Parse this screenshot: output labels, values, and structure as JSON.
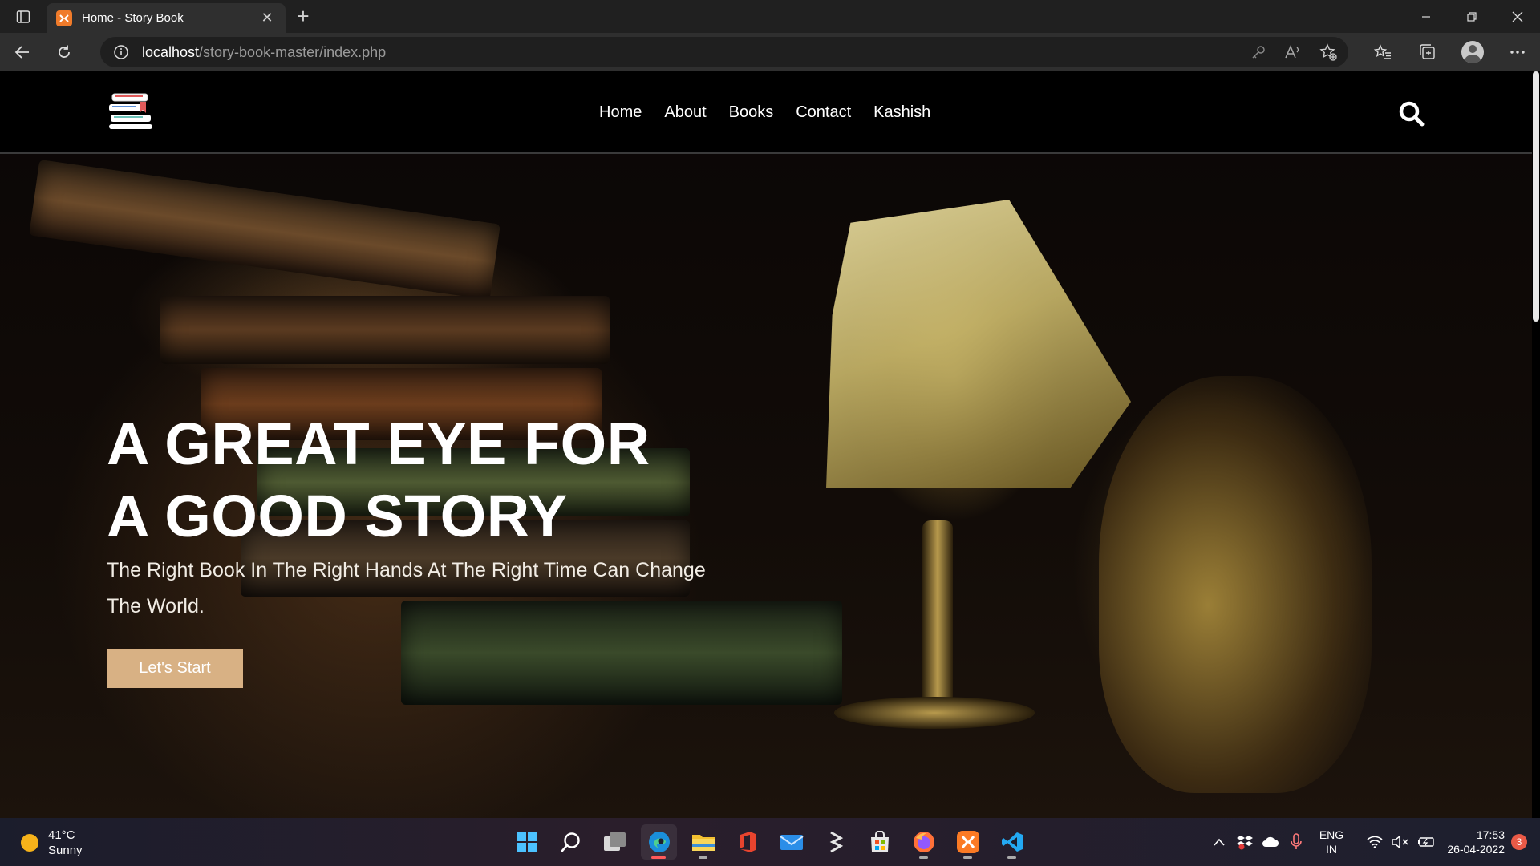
{
  "browser": {
    "tab_title": "Home - Story Book",
    "url_host": "localhost",
    "url_path": "/story-book-master/index.php"
  },
  "site": {
    "nav": [
      "Home",
      "About",
      "Books",
      "Contact",
      "Kashish"
    ],
    "hero": {
      "title_line1": "A GREAT EYE FOR",
      "title_line2": "A GOOD STORY",
      "subtitle_line1": "The Right Book In The Right Hands At The Right Time Can Change",
      "subtitle_line2": "The World.",
      "cta_label": "Let's Start"
    },
    "colors": {
      "cta": "#d8b184",
      "header_bg": "#000000"
    }
  },
  "taskbar": {
    "temperature": "41°C",
    "weather": "Sunny",
    "lang_line1": "ENG",
    "lang_line2": "IN",
    "time": "17:53",
    "date": "26-04-2022",
    "notification_count": "3"
  }
}
